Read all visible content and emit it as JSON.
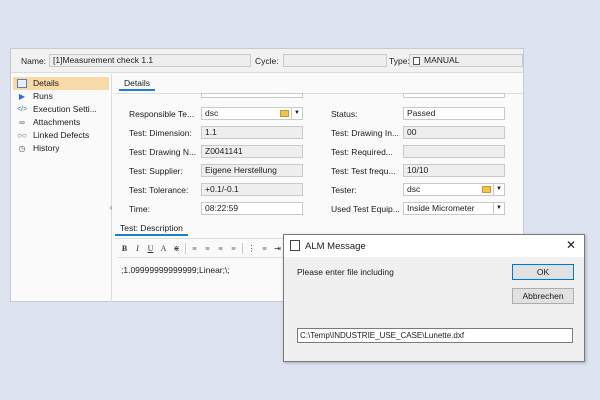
{
  "header": {
    "name_label": "Name:",
    "name_value": "[1]Measurement check 1.1",
    "cycle_label": "Cycle:",
    "cycle_value": "",
    "type_label": "Type:",
    "type_value": "MANUAL"
  },
  "sidebar": {
    "items": [
      {
        "label": "Details",
        "icon": "details-icon"
      },
      {
        "label": "Runs",
        "icon": "runs-icon"
      },
      {
        "label": "Execution Setti...",
        "icon": "execution-settings-icon"
      },
      {
        "label": "Attachments",
        "icon": "paperclip-icon"
      },
      {
        "label": "Linked Defects",
        "icon": "link-icon"
      },
      {
        "label": "History",
        "icon": "history-icon"
      }
    ]
  },
  "tabs": {
    "details": "Details",
    "description": "Test: Description"
  },
  "form": {
    "responsible_label": "Responsible Te...",
    "responsible_value": "dsc",
    "status_label": "Status:",
    "status_value": "Passed",
    "dimension_label": "Test: Dimension:",
    "dimension_value": "1.1",
    "drawing_in_label": "Test: Drawing In...",
    "drawing_in_value": "00",
    "drawing_n_label": "Test: Drawing N...",
    "drawing_n_value": "Z0041141",
    "required_label": "Test: Required...",
    "required_value": "",
    "supplier_label": "Test: Supplier:",
    "supplier_value": "Eigene Herstellung",
    "frequency_label": "Test: Test frequ...",
    "frequency_value": "10/10",
    "tolerance_label": "Test: Tolerance:",
    "tolerance_value": "+0.1/-0.1",
    "tester_label": "Tester:",
    "tester_value": "dsc",
    "time_label": "Time:",
    "time_value": "08:22:59",
    "equip_label": "Used Test Equip...",
    "equip_value": "Inside Micrometer"
  },
  "editor": {
    "content": ";1.09999999999999;Linear;\\;"
  },
  "dialog": {
    "title": "ALM Message",
    "message": "Please enter file including",
    "ok_label": "OK",
    "cancel_label": "Abbrechen",
    "path_value": "C:\\Temp\\INDUSTRIE_USE_CASE\\Lunette.dxf"
  },
  "colors": {
    "background": "#dde3ef",
    "selected_nav": "#f8d9a8",
    "tab_accent": "#1f7fc9",
    "mail_icon": "#f3c24a"
  }
}
